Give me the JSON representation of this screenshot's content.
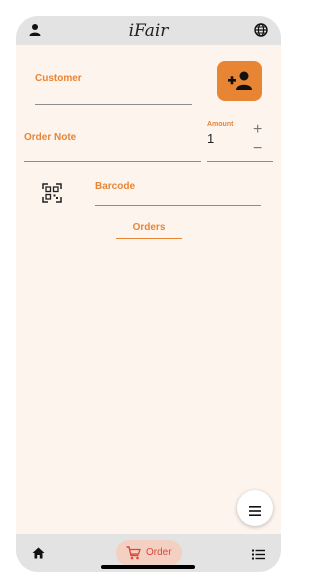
{
  "header": {
    "title": "iFair",
    "user_icon": "person-icon",
    "language_icon": "globe-icon"
  },
  "form": {
    "customer_label": "Customer",
    "customer_value": "",
    "add_customer_icon": "add-person-icon",
    "order_note_label": "Order Note",
    "order_note_value": "",
    "amount_label": "Amount",
    "amount_value": "1",
    "increment_symbol": "+",
    "decrement_symbol": "−",
    "barcode_icon": "qr-scan-icon",
    "barcode_label": "Barcode",
    "barcode_value": "",
    "orders_link": "Orders"
  },
  "fab": {
    "icon": "menu-lines-icon"
  },
  "bottom_nav": {
    "home_icon": "home-icon",
    "order_icon": "cart-icon",
    "order_label": "Order",
    "list_icon": "list-icon"
  },
  "colors": {
    "accent": "#e88535",
    "background": "#fdf4ee",
    "bar": "#e3e3e3",
    "order_pill": "#f4d0c3",
    "order_text": "#d9483b"
  }
}
